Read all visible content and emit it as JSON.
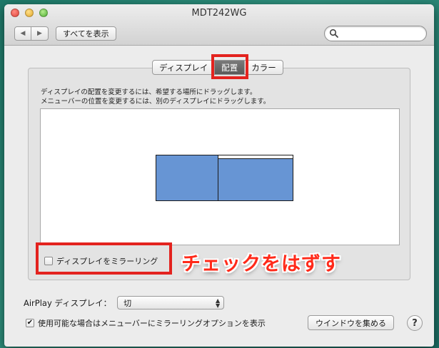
{
  "window": {
    "title": "MDT242WG"
  },
  "toolbar": {
    "back_label": "◀",
    "forward_label": "▶",
    "show_all_label": "すべてを表示",
    "search_value": "",
    "search_placeholder": ""
  },
  "tabs": [
    {
      "label": "ディスプレイ",
      "active": false
    },
    {
      "label": "配置",
      "active": true
    },
    {
      "label": "カラー",
      "active": false
    }
  ],
  "instructions": {
    "line1": "ディスプレイの配置を変更するには、希望する場所にドラッグします。",
    "line2": "メニューバーの位置を変更するには、別のディスプレイにドラッグします。"
  },
  "arrangement": {
    "displays": [
      "display-1",
      "display-2"
    ],
    "menubar_on": "display-2"
  },
  "mirror": {
    "label": "ディスプレイをミラーリング",
    "checked": false
  },
  "annotation": {
    "text": "チェックをはずす",
    "color": "#ff2a1a"
  },
  "airplay": {
    "label": "AirPlay ディスプレイ：",
    "selected": "切"
  },
  "menu_option": {
    "label": "使用可能な場合はメニューバーにミラーリングオプションを表示",
    "checked": true
  },
  "buttons": {
    "gather_windows": "ウインドウを集める",
    "help": "?"
  },
  "colors": {
    "highlight": "#e3231f",
    "display_fill": "#6795d4"
  }
}
